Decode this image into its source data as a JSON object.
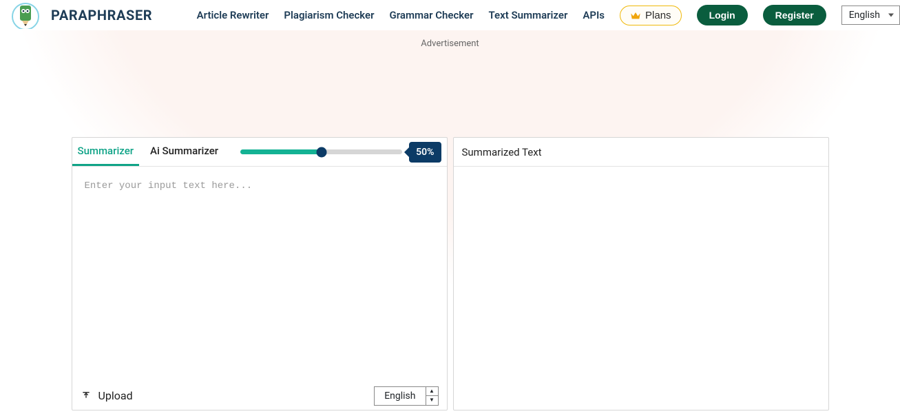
{
  "header": {
    "brand": "PARAPHRASER",
    "nav": {
      "article_rewriter": "Article Rewriter",
      "plagiarism_checker": "Plagiarism Checker",
      "grammar_checker": "Grammar Checker",
      "text_summarizer": "Text Summarizer",
      "apis": "APIs"
    },
    "plans_label": "Plans",
    "login_label": "Login",
    "register_label": "Register",
    "lang_selected": "English"
  },
  "ad_label": "Advertisement",
  "tool": {
    "tabs": {
      "summarizer": "Summarizer",
      "ai_summarizer": "Ai Summarizer"
    },
    "slider_percent": "50%",
    "input_placeholder": "Enter your input text here...",
    "upload_label": "Upload",
    "input_lang": "English",
    "output_header": "Summarized Text"
  }
}
